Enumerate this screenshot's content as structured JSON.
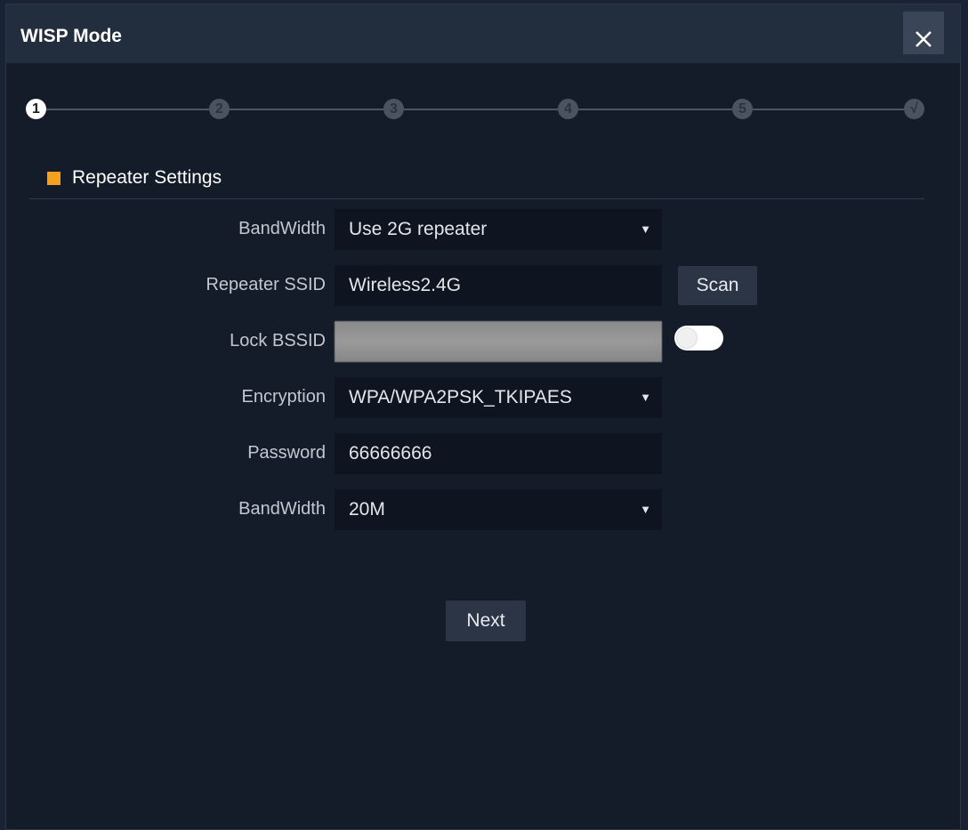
{
  "dialog": {
    "title": "WISP Mode",
    "close_icon": "close-icon"
  },
  "stepper": {
    "steps": [
      "1",
      "2",
      "3",
      "4",
      "5",
      "√"
    ],
    "active_step": 1
  },
  "section": {
    "title": "Repeater Settings",
    "marker_color": "#f5a11c"
  },
  "form": {
    "band_select": {
      "label": "BandWidth",
      "value": "Use 2G repeater"
    },
    "repeater_ssid": {
      "label": "Repeater SSID",
      "value": "Wireless2.4G",
      "scan_label": "Scan"
    },
    "lock_bssid": {
      "label": "Lock BSSID",
      "value": "",
      "toggle_on": false
    },
    "encryption": {
      "label": "Encryption",
      "value": "WPA/WPA2PSK_TKIPAES"
    },
    "password": {
      "label": "Password",
      "value": "66666666"
    },
    "bandwidth": {
      "label": "BandWidth",
      "value": "20M"
    }
  },
  "actions": {
    "next_label": "Next"
  },
  "caret_glyph": "▼"
}
